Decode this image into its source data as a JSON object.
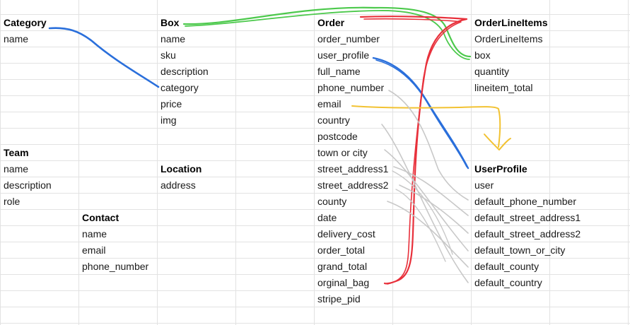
{
  "tables": {
    "category": {
      "header": "Category",
      "fields": [
        "name"
      ]
    },
    "box": {
      "header": "Box",
      "fields": [
        "name",
        "sku",
        "description",
        "category",
        "price",
        "img"
      ]
    },
    "order": {
      "header": "Order",
      "fields": [
        "order_number",
        "user_profile",
        "full_name",
        "phone_number",
        "email",
        "country",
        "postcode",
        "town or city",
        "street_address1",
        "street_address2",
        "county",
        "date",
        "delivery_cost",
        "order_total",
        "grand_total",
        "orginal_bag",
        "stripe_pid"
      ]
    },
    "orderlineitems": {
      "header": "OrderLineItems",
      "fields": [
        "OrderLineItems",
        "box",
        "quantity",
        "lineitem_total"
      ]
    },
    "team": {
      "header": "Team",
      "fields": [
        "name",
        "description",
        "role"
      ]
    },
    "location": {
      "header": "Location",
      "fields": [
        "address"
      ]
    },
    "contact": {
      "header": "Contact",
      "fields": [
        "name",
        "email",
        "phone_number"
      ]
    },
    "userprofile": {
      "header": "UserProfile",
      "fields": [
        "user",
        "default_phone_number",
        "default_street_address1",
        "default_street_address2",
        "default_town_or_city",
        "default_county",
        "default_country"
      ]
    }
  },
  "connector_colors": {
    "green": "#4cc94c",
    "blue": "#2a6fdb",
    "red": "#e8303b",
    "yellow": "#f2c232",
    "gray": "#c8c8c8"
  }
}
